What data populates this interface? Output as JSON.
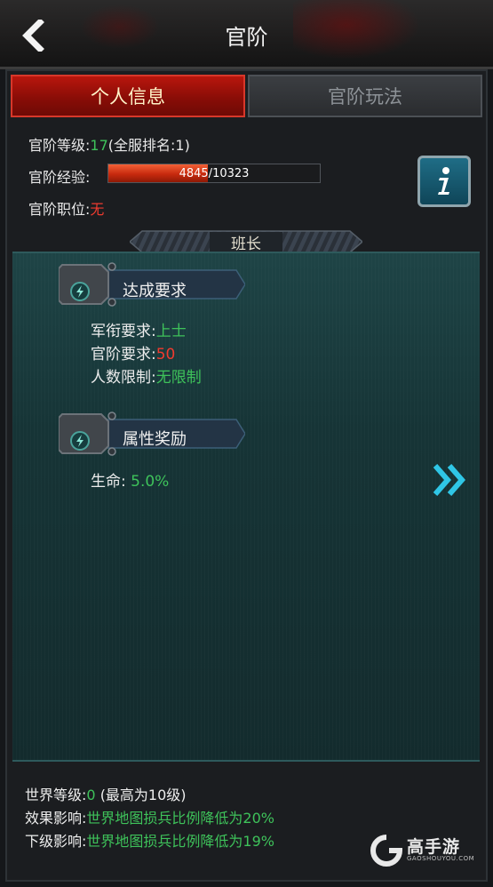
{
  "header": {
    "title": "官阶"
  },
  "tabs": [
    {
      "label": "个人信息",
      "active": true
    },
    {
      "label": "官阶玩法",
      "active": false
    }
  ],
  "profile": {
    "level_label": "官阶等级:",
    "level_value": "17",
    "rank_text": "(全服排名:1)",
    "exp_label": "官阶经验:",
    "exp_current": "4845",
    "exp_sep": "/",
    "exp_max": "10323",
    "exp_progress": 0.469,
    "position_label": "官阶职位:",
    "position_value": "无"
  },
  "rank_name": "班长",
  "requirements": {
    "title": "达成要求",
    "military_label": "军衔要求:",
    "military_value": "上士",
    "rank_label": "官阶要求:",
    "rank_value": "50",
    "limit_label": "人数限制:",
    "limit_value": "无限制"
  },
  "rewards": {
    "title": "属性奖励",
    "life_label": "生命:",
    "life_value": "5.0%"
  },
  "footer": {
    "world_label": "世界等级:",
    "world_value": "0",
    "world_max": "(最高为10级)",
    "effect_label": "效果影响:",
    "effect_value": "世界地图损兵比例降低为20%",
    "lower_label": "下级影响:",
    "lower_value": "世界地图损兵比例降低为19%"
  },
  "watermark": {
    "name": "高手游",
    "url": "GAOSHOUYOU.COM"
  },
  "colors": {
    "green": "#3ec25a",
    "red": "#ef3b2f",
    "tab_active": "#8a0d07",
    "panel_teal": "#163436",
    "accent_cyan": "#2fc6e6"
  },
  "icons": {
    "back": "chevron-left-icon",
    "info": "info-icon",
    "next": "double-chevron-right-icon"
  }
}
